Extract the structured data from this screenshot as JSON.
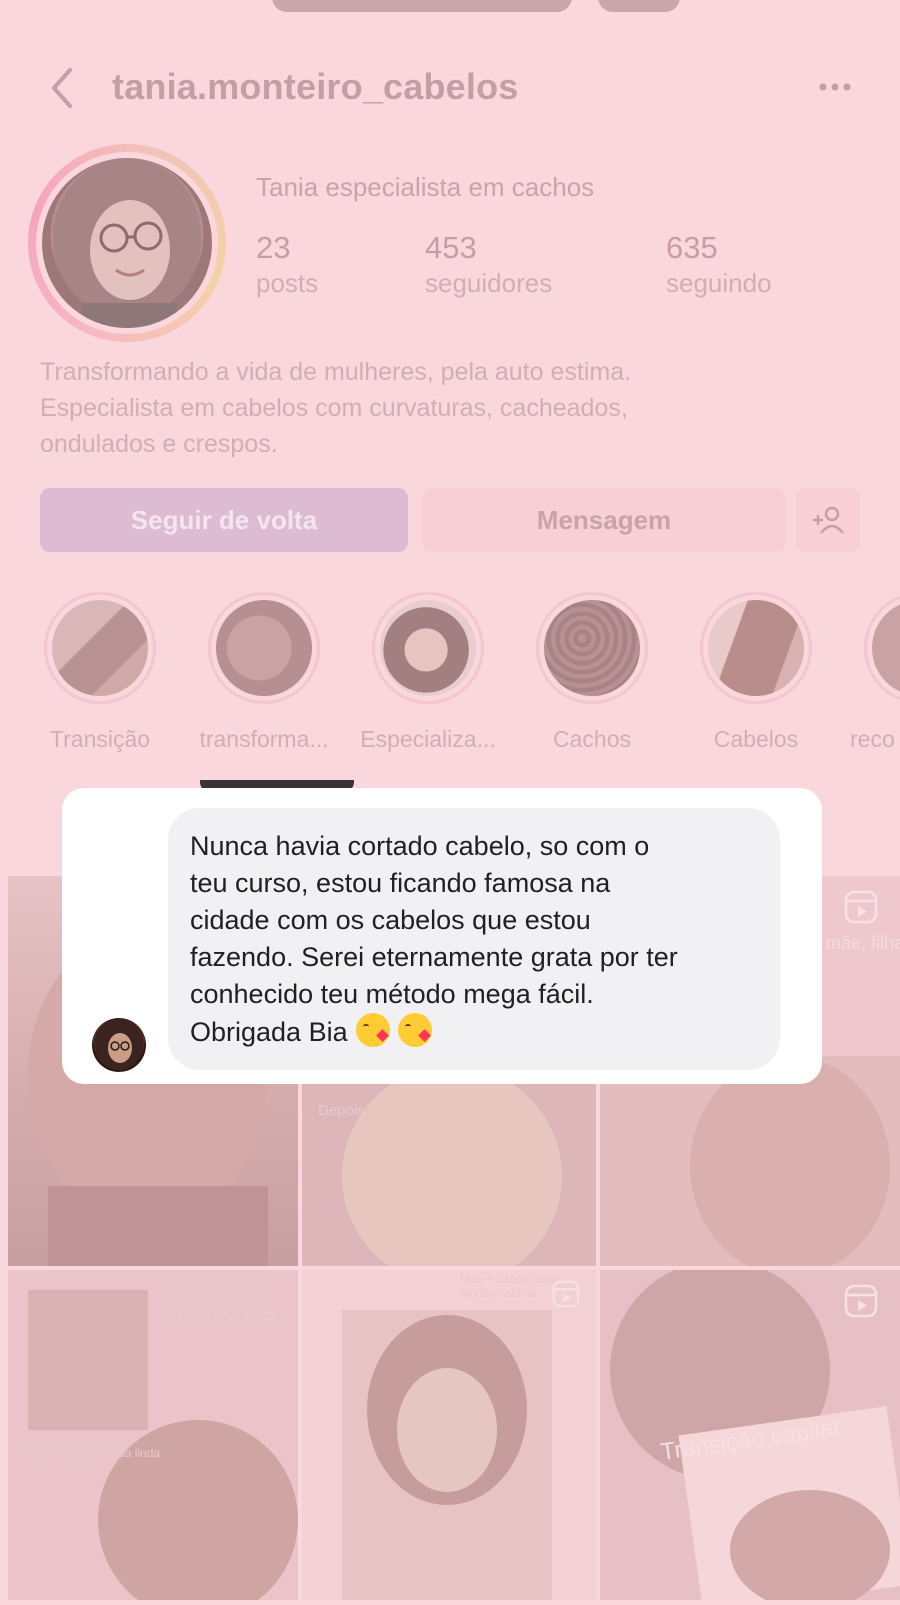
{
  "profile": {
    "username": "tania.monteiro_cabelos",
    "display_name": "Tania especialista em cachos",
    "stats": [
      {
        "value": "23",
        "label": "posts"
      },
      {
        "value": "453",
        "label": "seguidores"
      },
      {
        "value": "635",
        "label": "seguindo"
      }
    ],
    "bio_lines": [
      "Transformando a vida de mulheres, pela auto estima.",
      "Especialista em cabelos com curvaturas, cacheados,",
      "ondulados e crespos."
    ]
  },
  "actions": {
    "follow_back": "Seguir de volta",
    "message": "Mensagem"
  },
  "highlights": [
    {
      "label": "Transição"
    },
    {
      "label": "transforma..."
    },
    {
      "label": "Especializa..."
    },
    {
      "label": "Cachos"
    },
    {
      "label": "Cabelos"
    },
    {
      "label": "reco"
    }
  ],
  "grid_overlays": {
    "tile_mae_filha": "mãe, filha",
    "tile_depois": "Depois",
    "tile_big_chop": "Corte big chop, pera quem está na transir",
    "tile_handle": "@JAQUECABR",
    "tile_mais_uma": "Mais uma cacheada linda",
    "tile_mae_cabelo": "Mãe + cabelo com muitos cachos",
    "tile_transicao": "Transição capilar."
  },
  "testimonial": {
    "lines": [
      "Nunca havia cortado cabelo, so com o",
      "teu curso, estou ficando famosa na",
      "cidade com os cabelos que estou",
      "fazendo. Serei eternamente grata por ter",
      "conhecido teu método mega fácil.",
      "Obrigada Bia"
    ],
    "emojis": [
      "kissing-heart-emoji",
      "kissing-heart-emoji"
    ]
  },
  "colors": {
    "page_tint": "#fad7dc",
    "follow_button": "#dcbbd3",
    "bubble": "#f1f1f4",
    "card": "#ffffff"
  }
}
